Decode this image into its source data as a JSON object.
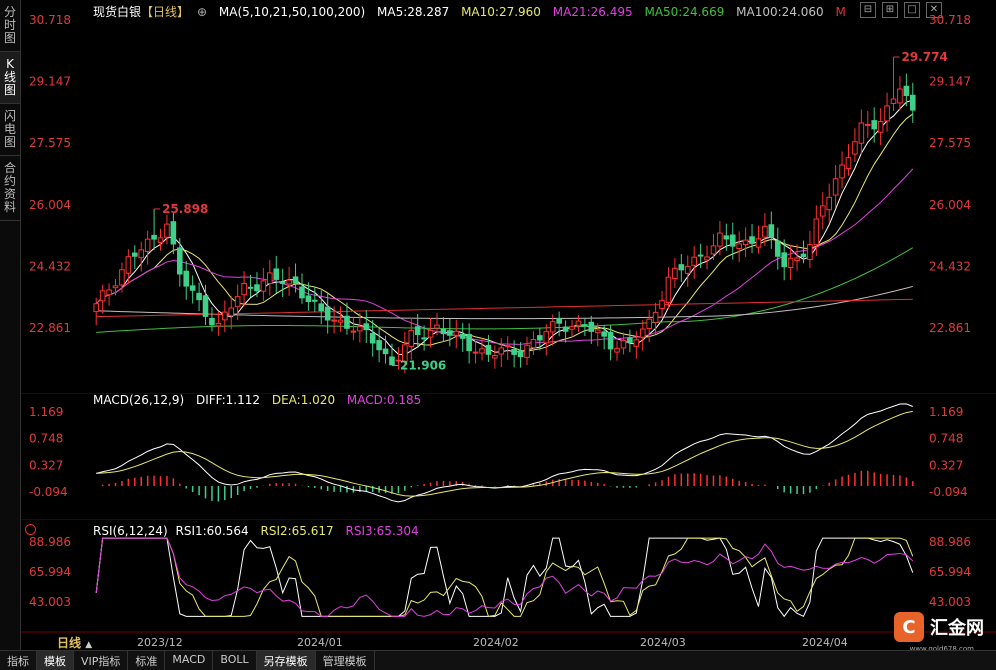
{
  "sidebar": {
    "tabs": [
      {
        "label": [
          "分",
          "时",
          "图"
        ],
        "active": false
      },
      {
        "label": [
          "K",
          "线",
          "图"
        ],
        "active": true
      },
      {
        "label": [
          "闪",
          "电",
          "图"
        ],
        "active": false
      },
      {
        "label": [
          "合",
          "约",
          "资",
          "料"
        ],
        "active": false
      }
    ]
  },
  "price_panel": {
    "instrument": "现货白银",
    "period_tag": "【日线】",
    "ma_params": "MA(5,10,21,50,100,200)",
    "ma5": "MA5:28.287",
    "ma10": "MA10:27.960",
    "ma21": "MA21:26.495",
    "ma50": "MA50:24.669",
    "ma100": "MA100:24.060",
    "ma_more": "M",
    "y_ticks": [
      "30.718",
      "29.147",
      "27.575",
      "26.004",
      "24.432",
      "22.861"
    ],
    "high_label": "29.774",
    "mid_high_label": "25.898",
    "low_label": "21.906"
  },
  "macd_panel": {
    "params": "MACD(26,12,9)",
    "diff": "DIFF:1.112",
    "dea": "DEA:1.020",
    "macd": "MACD:0.185",
    "y_ticks": [
      "1.169",
      "0.748",
      "0.327",
      "-0.094"
    ]
  },
  "rsi_panel": {
    "params": "RSI(6,12,24)",
    "rsi1": "RSI1:60.564",
    "rsi2": "RSI2:65.617",
    "rsi3": "RSI3:65.304",
    "y_ticks": [
      "88.986",
      "65.994",
      "43.003"
    ]
  },
  "x_axis": {
    "period_label": "日线",
    "period_arrow": "▲",
    "dates": [
      "2023/12",
      "2024/01",
      "2024/02",
      "2024/03",
      "2024/04"
    ]
  },
  "window_controls": [
    "icon-1",
    "icon-2",
    "icon-3",
    "icon-4"
  ],
  "bottom_bar": {
    "items": [
      {
        "label": "指标",
        "active": false
      },
      {
        "label": "模板",
        "active": true
      },
      {
        "label": "VIP指标",
        "active": false
      },
      {
        "label": "标准",
        "active": false
      },
      {
        "label": "MACD",
        "active": false
      },
      {
        "label": "BOLL",
        "active": false
      },
      {
        "label": "另存模板",
        "active": true
      },
      {
        "label": "管理模板",
        "active": false
      }
    ]
  },
  "brand": {
    "name": "汇金网",
    "url": "www.gold678.com"
  },
  "colors": {
    "up": "#ff3030",
    "down": "#3fd08a",
    "ma5": "#ffffff",
    "ma10": "#e8e86a",
    "ma21": "#e040e0",
    "ma50": "#40c040",
    "ma100": "#c0c0c0",
    "ma200": "#e03030"
  },
  "chart_data": {
    "type": "candlestick",
    "y_axis_price": [
      22.861,
      30.718
    ],
    "y_axis_macd": [
      -0.094,
      1.169
    ],
    "y_axis_rsi": [
      43.003,
      88.986
    ],
    "x_range": [
      "2023/11",
      "2024/04"
    ],
    "annotations": [
      {
        "label": "29.774",
        "meaning": "high"
      },
      {
        "label": "25.898",
        "meaning": "local high"
      },
      {
        "label": "21.906",
        "meaning": "low"
      }
    ]
  }
}
